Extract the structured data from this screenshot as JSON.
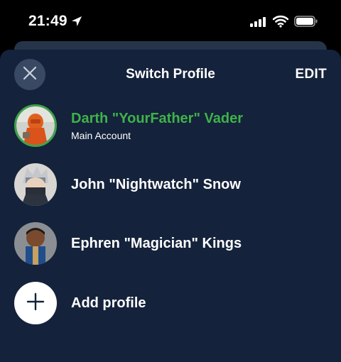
{
  "status_bar": {
    "time": "21:49",
    "icons": [
      "location-arrow-icon",
      "cellular-signal-icon",
      "wifi-icon",
      "battery-icon"
    ]
  },
  "sheet": {
    "title": "Switch Profile",
    "edit_label": "EDIT",
    "close_icon": "close-icon"
  },
  "profiles": [
    {
      "name": "Darth \"YourFather\" Vader",
      "subtitle": "Main Account",
      "active": true
    },
    {
      "name": "John \"Nightwatch\" Snow",
      "active": false
    },
    {
      "name": "Ephren \"Magician\" Kings",
      "active": false
    }
  ],
  "add_profile": {
    "label": "Add profile",
    "icon": "plus-icon"
  },
  "colors": {
    "sheet_background": "#14223b",
    "active_profile": "#3fb24a",
    "close_button": "#3a4963"
  }
}
